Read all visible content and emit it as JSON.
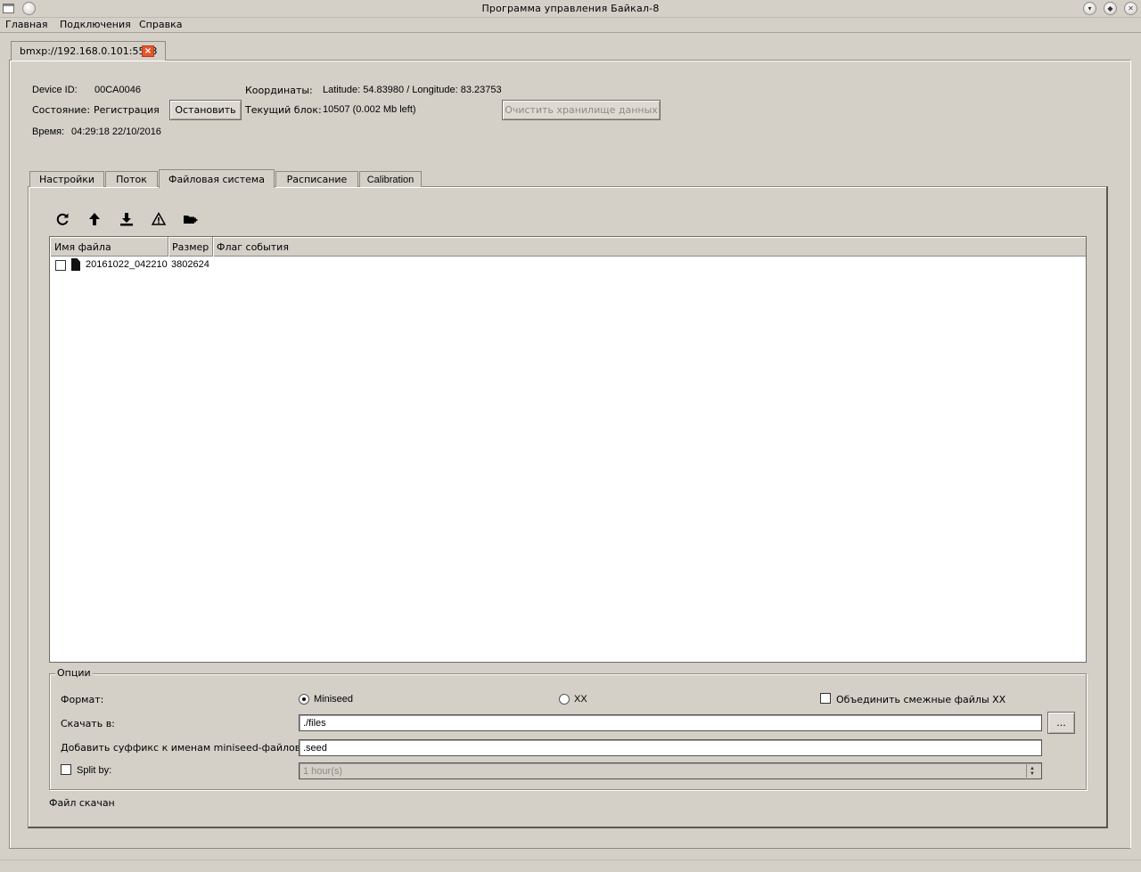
{
  "window": {
    "title": "Программа управления Байкал-8"
  },
  "menu": {
    "items": [
      "Главная",
      "Подключения",
      "Справка"
    ]
  },
  "connection_tab": {
    "label": "bmxp://192.168.0.101:5513",
    "close_icon": "close-icon"
  },
  "device": {
    "id_label": "Device ID:",
    "id_value": "00CA0046",
    "state_label": "Состояние:",
    "state_value": "Регистрация",
    "stop_button": "Остановить",
    "time_label": "Время:",
    "time_value": "04:29:18 22/10/2016",
    "coords_label": "Координаты:",
    "coords_value": "Latitude: 54.83980 / Longitude: 83.23753",
    "block_label": "Текущий блок:",
    "block_value": "10507 (0.002 Mb left)",
    "clear_button": "Очистить хранилище данных"
  },
  "tabs": [
    {
      "label": "Настройки",
      "active": false
    },
    {
      "label": "Поток",
      "active": false
    },
    {
      "label": "Файловая система",
      "active": true
    },
    {
      "label": "Расписание",
      "active": false
    },
    {
      "label": "Calibration",
      "active": false
    }
  ],
  "toolbar": {
    "icons": [
      "refresh-icon",
      "upload-icon",
      "download-icon",
      "warning-icon",
      "add-folder-icon"
    ]
  },
  "table": {
    "columns": [
      "Имя файла",
      "Размер",
      "Флаг события"
    ],
    "rows": [
      {
        "checked": false,
        "name": "20161022_042210",
        "size": "3802624",
        "flag": ""
      }
    ]
  },
  "options": {
    "group_title": "Опции",
    "format_label": "Формат:",
    "format_miniseed": "Miniseed",
    "format_xx": "XX",
    "format_selected": "Miniseed",
    "merge_label": "Объединить смежные файлы XX",
    "merge_checked": false,
    "download_label": "Скачать в:",
    "download_path": "./files",
    "browse_button": "...",
    "suffix_label": "Добавить суффикс к именам miniseed-файлов:",
    "suffix_value": ".seed",
    "split_label": "Split by:",
    "split_checked": false,
    "split_value": "1 hour(s)"
  },
  "status": {
    "message": "Файл скачан"
  },
  "colors": {
    "background": "#d4d0c8",
    "close_tab": "#e4572e",
    "table_bg": "#ffffff"
  }
}
